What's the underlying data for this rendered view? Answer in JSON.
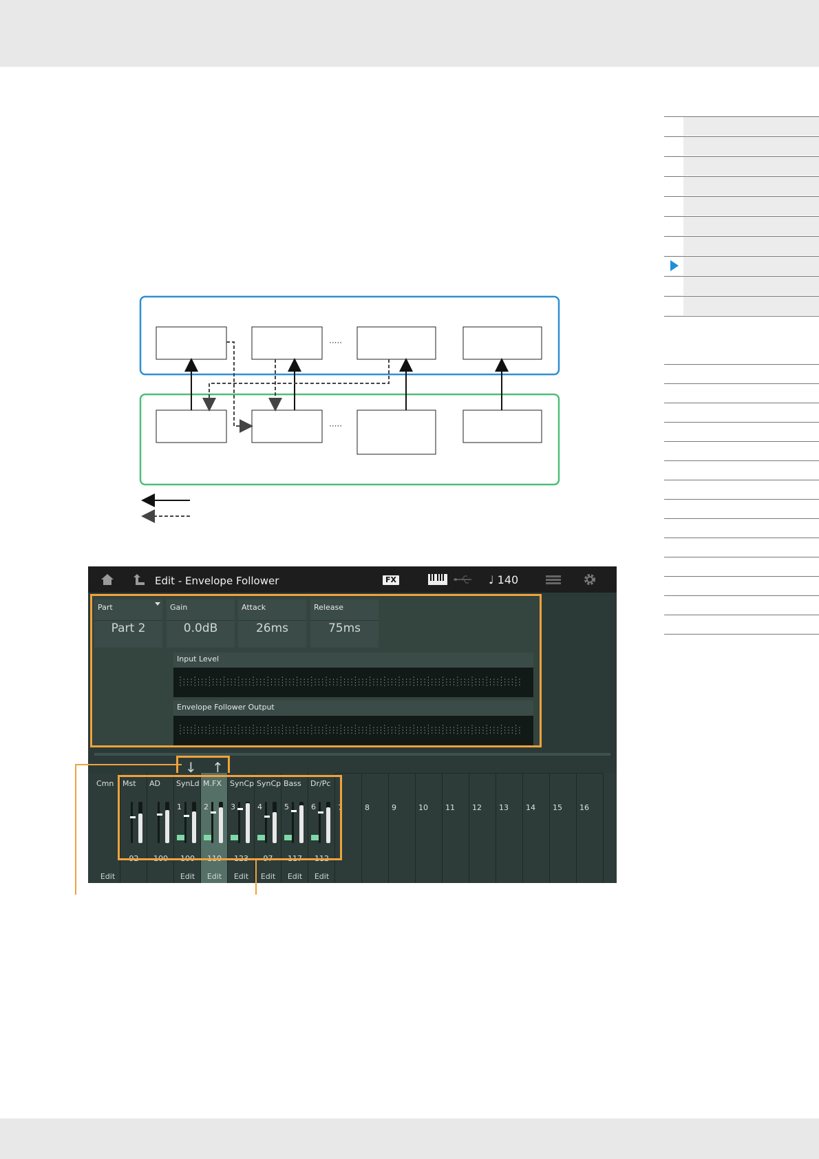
{
  "screen": {
    "title": "Edit - Envelope Follower",
    "fx_badge": "FX",
    "tempo": "♩ 140"
  },
  "params": [
    {
      "label": "Part",
      "value": "Part 2"
    },
    {
      "label": "Gain",
      "value": "0.0dB"
    },
    {
      "label": "Attack",
      "value": "26ms"
    },
    {
      "label": "Release",
      "value": "75ms"
    }
  ],
  "meters": {
    "input_label": "Input Level",
    "output_label": "Envelope Follower Output"
  },
  "arrows": {
    "down": "↓",
    "up": "↑"
  },
  "mixer": {
    "cmn": "Cmn",
    "columns": [
      {
        "name": "Mst",
        "num": "",
        "value": "92",
        "level": 0.72,
        "kb": false,
        "edit": ""
      },
      {
        "name": "AD",
        "num": "",
        "value": "100",
        "level": 0.8,
        "kb": false,
        "edit": ""
      },
      {
        "name": "SynLd",
        "num": "1",
        "value": "100",
        "level": 0.76,
        "kb": true,
        "edit": "Edit"
      },
      {
        "name": "M.FX",
        "num": "2",
        "value": "110",
        "level": 0.86,
        "kb": true,
        "edit": "Edit"
      },
      {
        "name": "SynCp",
        "num": "3",
        "value": "123",
        "level": 0.96,
        "kb": true,
        "edit": "Edit"
      },
      {
        "name": "SynCp",
        "num": "4",
        "value": "97",
        "level": 0.75,
        "kb": true,
        "edit": "Edit"
      },
      {
        "name": "Bass",
        "num": "5",
        "value": "117",
        "level": 0.91,
        "kb": true,
        "edit": "Edit"
      },
      {
        "name": "Dr/Pc",
        "num": "6",
        "value": "112",
        "level": 0.87,
        "kb": true,
        "edit": "Edit"
      }
    ],
    "empty_parts": [
      "7",
      "8",
      "9",
      "10",
      "11",
      "12",
      "13",
      "14",
      "15",
      "16"
    ],
    "cmn_edit": "Edit"
  },
  "diagram": {
    "dots": "·····"
  }
}
